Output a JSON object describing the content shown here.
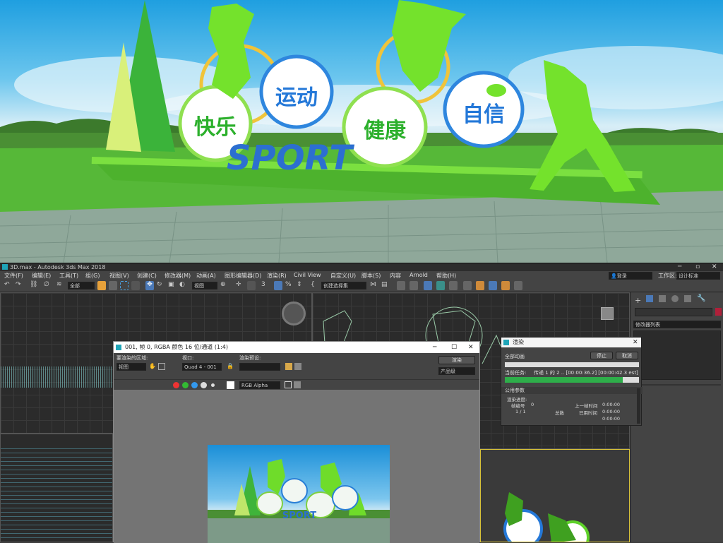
{
  "hero": {
    "badges": [
      "快乐",
      "运动",
      "健康",
      "自信"
    ],
    "sport": "SPORT"
  },
  "titlebar": {
    "title": "3D.max - Autodesk 3ds Max 2018"
  },
  "menu": [
    "文件(F)",
    "编辑(E)",
    "工具(T)",
    "组(G)",
    "视图(V)",
    "创建(C)",
    "修改器(M)",
    "动画(A)",
    "图形编辑器(D)",
    "渲染(R)",
    "Civil View",
    "自定义(U)",
    "脚本(S)",
    "内容",
    "Arnold",
    "帮助(H)"
  ],
  "menu_right": {
    "login": "登录",
    "workspace_label": "工作区:",
    "workspace": "设计标准"
  },
  "toolbar": {
    "filter": "全部",
    "view": "视图",
    "selset": "创建选择集"
  },
  "command_panel": {
    "modifier_list": "修改器列表"
  },
  "frame_window": {
    "title": "001, 帧 0, RGBA 颜色 16 位/通道 (1:4)",
    "area_label": "要渲染的区域:",
    "area_value": "视图",
    "viewport_label": "视口:",
    "viewport_value": "Quad 4 - 001",
    "preset_label": "渲染预设:",
    "render_btn": "渲染",
    "product_level": "产品级",
    "channel": "RGB Alpha"
  },
  "render_dialog": {
    "title": "渲染",
    "all_anim": "全部动画",
    "pause": "停止",
    "cancel": "取消",
    "current_task": "当前任务:",
    "task_text": "传递 1 的 2 .. [00:00:36.2] [00:00:42.3 est]",
    "progress": 0.88,
    "section": "公用参数",
    "render_progress": "渲染进度:",
    "frame_no_label": "帧编号",
    "frame_no": "0",
    "prev_time_label": "上一帧时间",
    "prev_time": "0:00:00",
    "frame_count": "1 / 1",
    "total_label": "总数",
    "elapsed_label": "已用时间",
    "elapsed": "0:00:00",
    "remain_time": "0:00:00"
  },
  "preview_inner": {
    "sport": "SPORT"
  },
  "colors": {
    "green": "#5fd12a",
    "blue": "#2478d8",
    "ui": "#444444"
  }
}
